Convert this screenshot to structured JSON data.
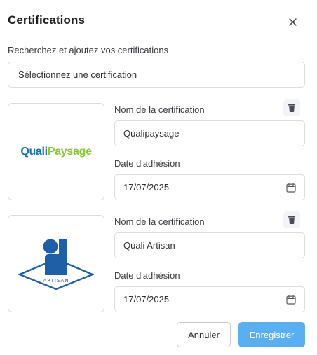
{
  "modal": {
    "title": "Certifications",
    "subtitle": "Recherchez et ajoutez vos certifications",
    "search_select": {
      "value": "Sélectionnez une certification"
    }
  },
  "certifications": [
    {
      "logo": {
        "icon": "qualipaysage-logo",
        "text_part1": "Quali",
        "text_part2": "Paysage",
        "colors": [
          "#1a6fb5",
          "#8cc63f"
        ]
      },
      "name_label": "Nom de la certification",
      "name_value": "Qualipaysage",
      "date_label": "Date d'adhésion",
      "date_value": "17/07/2025"
    },
    {
      "logo": {
        "icon": "quali-artisan-logo",
        "text": "ARTISAN",
        "colors": [
          "#1f5fa8"
        ]
      },
      "name_label": "Nom de la certification",
      "name_value": "Quali Artisan",
      "date_label": "Date d'adhésion",
      "date_value": "17/07/2025"
    }
  ],
  "actions": {
    "cancel_label": "Annuler",
    "save_label": "Enregistrer"
  },
  "colors": {
    "primary": "#5aaef2",
    "border": "#dcdde3",
    "text": "#2d2d33"
  }
}
